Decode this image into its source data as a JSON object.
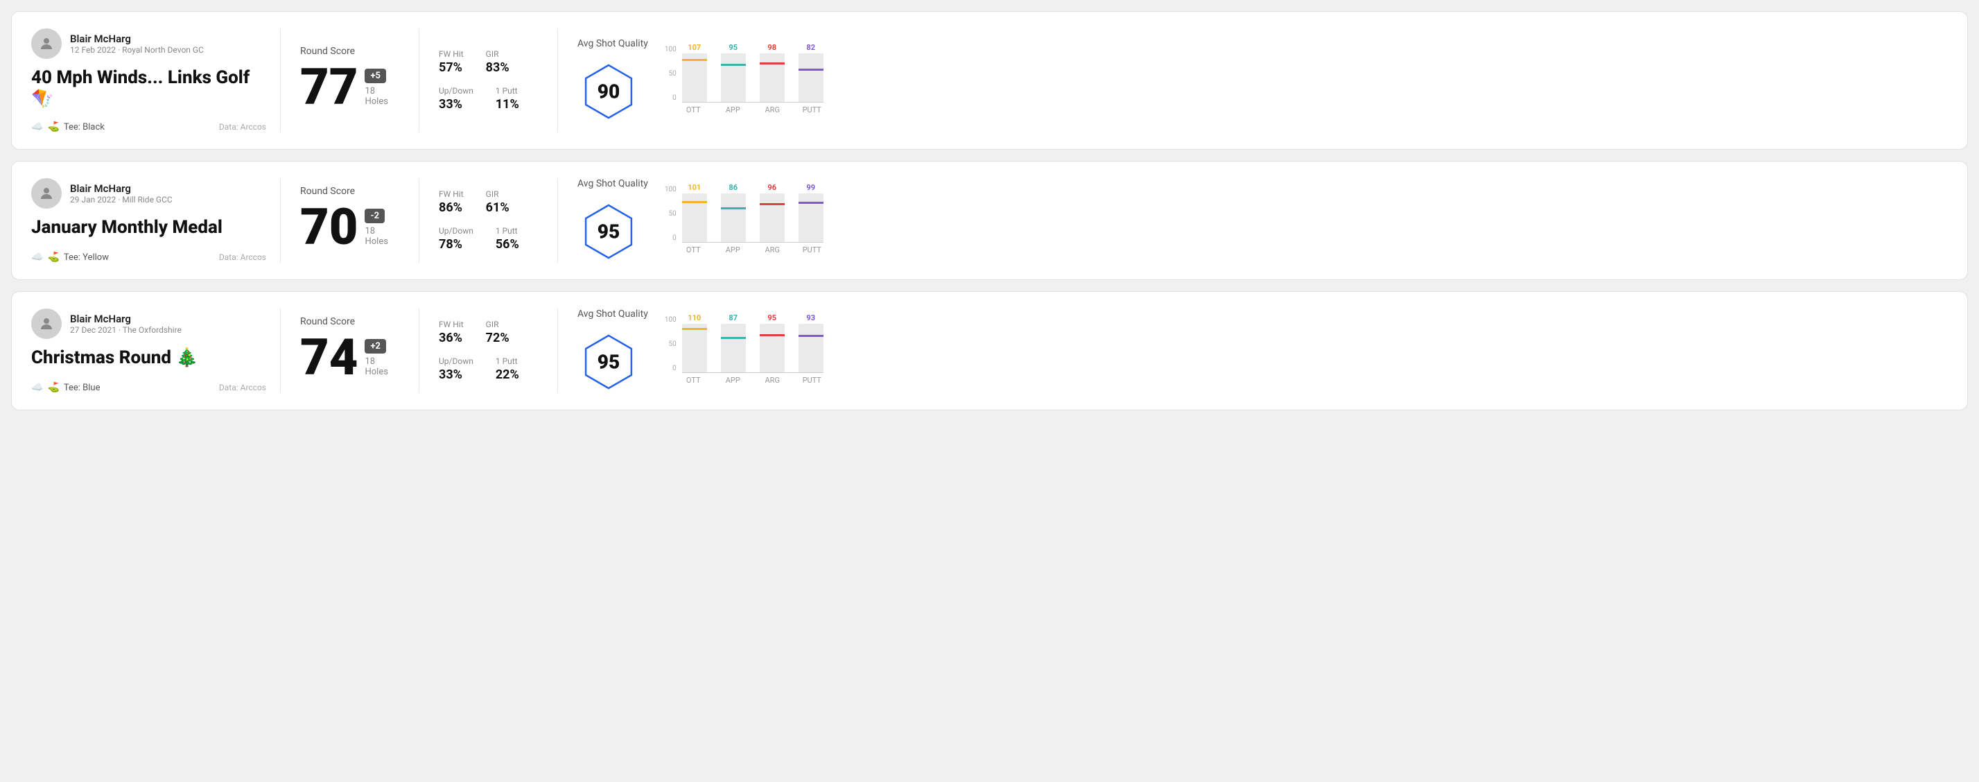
{
  "rounds": [
    {
      "id": "round-1",
      "player": {
        "name": "Blair McHarg",
        "date": "12 Feb 2022",
        "course": "Royal North Devon GC"
      },
      "title": "40 Mph Winds... Links Golf 🪁",
      "tee": "Black",
      "data_source": "Data: Arccos",
      "score": {
        "value": "77",
        "modifier": "+5",
        "modifier_type": "positive",
        "holes": "18 Holes"
      },
      "stats": {
        "fw_hit_label": "FW Hit",
        "fw_hit_value": "57%",
        "gir_label": "GIR",
        "gir_value": "83%",
        "updown_label": "Up/Down",
        "updown_value": "33%",
        "one_putt_label": "1 Putt",
        "one_putt_value": "11%"
      },
      "avg_shot_quality": {
        "label": "Avg Shot Quality",
        "score": "90"
      },
      "chart": {
        "bars": [
          {
            "label": "OTT",
            "value": 107,
            "color": "#f0b429",
            "max": 120
          },
          {
            "label": "APP",
            "value": 95,
            "color": "#38b2ac",
            "max": 120
          },
          {
            "label": "ARG",
            "value": 98,
            "color": "#e53e3e",
            "max": 120
          },
          {
            "label": "PUTT",
            "value": 82,
            "color": "#805ad5",
            "max": 120
          }
        ],
        "y_labels": [
          "100",
          "50",
          "0"
        ]
      }
    },
    {
      "id": "round-2",
      "player": {
        "name": "Blair McHarg",
        "date": "29 Jan 2022",
        "course": "Mill Ride GCC"
      },
      "title": "January Monthly Medal",
      "tee": "Yellow",
      "data_source": "Data: Arccos",
      "score": {
        "value": "70",
        "modifier": "-2",
        "modifier_type": "negative",
        "holes": "18 Holes"
      },
      "stats": {
        "fw_hit_label": "FW Hit",
        "fw_hit_value": "86%",
        "gir_label": "GIR",
        "gir_value": "61%",
        "updown_label": "Up/Down",
        "updown_value": "78%",
        "one_putt_label": "1 Putt",
        "one_putt_value": "56%"
      },
      "avg_shot_quality": {
        "label": "Avg Shot Quality",
        "score": "95"
      },
      "chart": {
        "bars": [
          {
            "label": "OTT",
            "value": 101,
            "color": "#f0b429",
            "max": 120
          },
          {
            "label": "APP",
            "value": 86,
            "color": "#38b2ac",
            "max": 120
          },
          {
            "label": "ARG",
            "value": 96,
            "color": "#e53e3e",
            "max": 120
          },
          {
            "label": "PUTT",
            "value": 99,
            "color": "#805ad5",
            "max": 120
          }
        ],
        "y_labels": [
          "100",
          "50",
          "0"
        ]
      }
    },
    {
      "id": "round-3",
      "player": {
        "name": "Blair McHarg",
        "date": "27 Dec 2021",
        "course": "The Oxfordshire"
      },
      "title": "Christmas Round 🎄",
      "tee": "Blue",
      "data_source": "Data: Arccos",
      "score": {
        "value": "74",
        "modifier": "+2",
        "modifier_type": "positive",
        "holes": "18 Holes"
      },
      "stats": {
        "fw_hit_label": "FW Hit",
        "fw_hit_value": "36%",
        "gir_label": "GIR",
        "gir_value": "72%",
        "updown_label": "Up/Down",
        "updown_value": "33%",
        "one_putt_label": "1 Putt",
        "one_putt_value": "22%"
      },
      "avg_shot_quality": {
        "label": "Avg Shot Quality",
        "score": "95"
      },
      "chart": {
        "bars": [
          {
            "label": "OTT",
            "value": 110,
            "color": "#f0b429",
            "max": 120
          },
          {
            "label": "APP",
            "value": 87,
            "color": "#38b2ac",
            "max": 120
          },
          {
            "label": "ARG",
            "value": 95,
            "color": "#e53e3e",
            "max": 120
          },
          {
            "label": "PUTT",
            "value": 93,
            "color": "#805ad5",
            "max": 120
          }
        ],
        "y_labels": [
          "100",
          "50",
          "0"
        ]
      }
    }
  ],
  "ui": {
    "round_score_label": "Round Score",
    "avg_shot_quality_label": "Avg Shot Quality",
    "data_arccos": "Data: Arccos",
    "tee_prefix": "Tee:"
  }
}
